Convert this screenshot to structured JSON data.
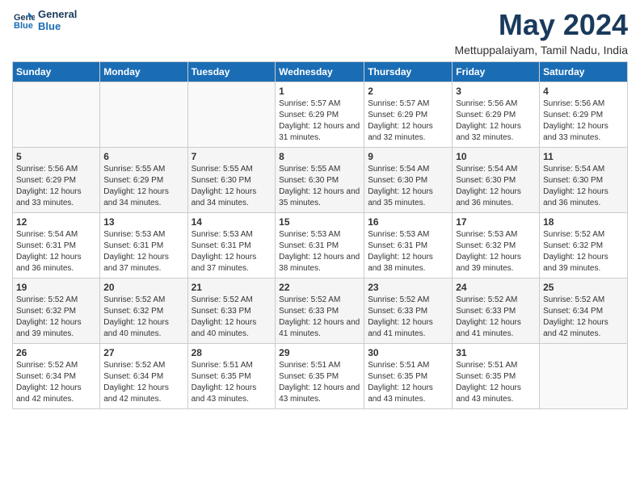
{
  "header": {
    "logo_line1": "General",
    "logo_line2": "Blue",
    "title": "May 2024",
    "location": "Mettuppalaiyam, Tamil Nadu, India"
  },
  "weekdays": [
    "Sunday",
    "Monday",
    "Tuesday",
    "Wednesday",
    "Thursday",
    "Friday",
    "Saturday"
  ],
  "weeks": [
    [
      {
        "day": "",
        "info": ""
      },
      {
        "day": "",
        "info": ""
      },
      {
        "day": "",
        "info": ""
      },
      {
        "day": "1",
        "info": "Sunrise: 5:57 AM\nSunset: 6:29 PM\nDaylight: 12 hours and 31 minutes."
      },
      {
        "day": "2",
        "info": "Sunrise: 5:57 AM\nSunset: 6:29 PM\nDaylight: 12 hours and 32 minutes."
      },
      {
        "day": "3",
        "info": "Sunrise: 5:56 AM\nSunset: 6:29 PM\nDaylight: 12 hours and 32 minutes."
      },
      {
        "day": "4",
        "info": "Sunrise: 5:56 AM\nSunset: 6:29 PM\nDaylight: 12 hours and 33 minutes."
      }
    ],
    [
      {
        "day": "5",
        "info": "Sunrise: 5:56 AM\nSunset: 6:29 PM\nDaylight: 12 hours and 33 minutes."
      },
      {
        "day": "6",
        "info": "Sunrise: 5:55 AM\nSunset: 6:29 PM\nDaylight: 12 hours and 34 minutes."
      },
      {
        "day": "7",
        "info": "Sunrise: 5:55 AM\nSunset: 6:30 PM\nDaylight: 12 hours and 34 minutes."
      },
      {
        "day": "8",
        "info": "Sunrise: 5:55 AM\nSunset: 6:30 PM\nDaylight: 12 hours and 35 minutes."
      },
      {
        "day": "9",
        "info": "Sunrise: 5:54 AM\nSunset: 6:30 PM\nDaylight: 12 hours and 35 minutes."
      },
      {
        "day": "10",
        "info": "Sunrise: 5:54 AM\nSunset: 6:30 PM\nDaylight: 12 hours and 36 minutes."
      },
      {
        "day": "11",
        "info": "Sunrise: 5:54 AM\nSunset: 6:30 PM\nDaylight: 12 hours and 36 minutes."
      }
    ],
    [
      {
        "day": "12",
        "info": "Sunrise: 5:54 AM\nSunset: 6:31 PM\nDaylight: 12 hours and 36 minutes."
      },
      {
        "day": "13",
        "info": "Sunrise: 5:53 AM\nSunset: 6:31 PM\nDaylight: 12 hours and 37 minutes."
      },
      {
        "day": "14",
        "info": "Sunrise: 5:53 AM\nSunset: 6:31 PM\nDaylight: 12 hours and 37 minutes."
      },
      {
        "day": "15",
        "info": "Sunrise: 5:53 AM\nSunset: 6:31 PM\nDaylight: 12 hours and 38 minutes."
      },
      {
        "day": "16",
        "info": "Sunrise: 5:53 AM\nSunset: 6:31 PM\nDaylight: 12 hours and 38 minutes."
      },
      {
        "day": "17",
        "info": "Sunrise: 5:53 AM\nSunset: 6:32 PM\nDaylight: 12 hours and 39 minutes."
      },
      {
        "day": "18",
        "info": "Sunrise: 5:52 AM\nSunset: 6:32 PM\nDaylight: 12 hours and 39 minutes."
      }
    ],
    [
      {
        "day": "19",
        "info": "Sunrise: 5:52 AM\nSunset: 6:32 PM\nDaylight: 12 hours and 39 minutes."
      },
      {
        "day": "20",
        "info": "Sunrise: 5:52 AM\nSunset: 6:32 PM\nDaylight: 12 hours and 40 minutes."
      },
      {
        "day": "21",
        "info": "Sunrise: 5:52 AM\nSunset: 6:33 PM\nDaylight: 12 hours and 40 minutes."
      },
      {
        "day": "22",
        "info": "Sunrise: 5:52 AM\nSunset: 6:33 PM\nDaylight: 12 hours and 41 minutes."
      },
      {
        "day": "23",
        "info": "Sunrise: 5:52 AM\nSunset: 6:33 PM\nDaylight: 12 hours and 41 minutes."
      },
      {
        "day": "24",
        "info": "Sunrise: 5:52 AM\nSunset: 6:33 PM\nDaylight: 12 hours and 41 minutes."
      },
      {
        "day": "25",
        "info": "Sunrise: 5:52 AM\nSunset: 6:34 PM\nDaylight: 12 hours and 42 minutes."
      }
    ],
    [
      {
        "day": "26",
        "info": "Sunrise: 5:52 AM\nSunset: 6:34 PM\nDaylight: 12 hours and 42 minutes."
      },
      {
        "day": "27",
        "info": "Sunrise: 5:52 AM\nSunset: 6:34 PM\nDaylight: 12 hours and 42 minutes."
      },
      {
        "day": "28",
        "info": "Sunrise: 5:51 AM\nSunset: 6:35 PM\nDaylight: 12 hours and 43 minutes."
      },
      {
        "day": "29",
        "info": "Sunrise: 5:51 AM\nSunset: 6:35 PM\nDaylight: 12 hours and 43 minutes."
      },
      {
        "day": "30",
        "info": "Sunrise: 5:51 AM\nSunset: 6:35 PM\nDaylight: 12 hours and 43 minutes."
      },
      {
        "day": "31",
        "info": "Sunrise: 5:51 AM\nSunset: 6:35 PM\nDaylight: 12 hours and 43 minutes."
      },
      {
        "day": "",
        "info": ""
      }
    ]
  ]
}
